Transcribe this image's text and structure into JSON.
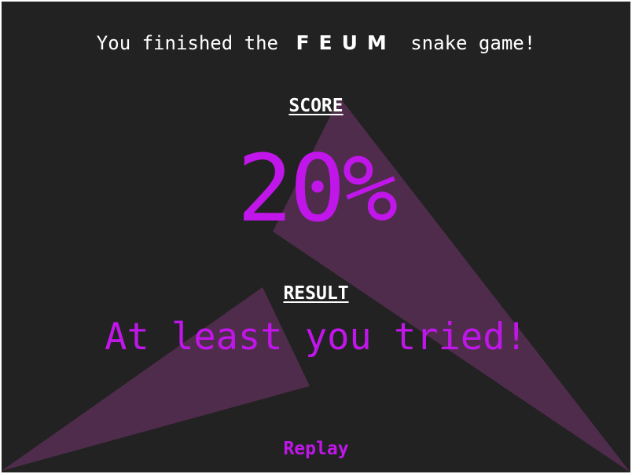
{
  "intro": {
    "prefix": "You finished the",
    "brand": "FEUM",
    "suffix": "snake game!"
  },
  "score": {
    "label": "SCORE",
    "value": "20%"
  },
  "result": {
    "label": "RESULT",
    "value": "At least you tried!"
  },
  "replay_label": "Replay",
  "colors": {
    "background": "#222222",
    "accent": "#c016ea",
    "shape_fill": "#4f2c4b",
    "text": "#ffffff"
  }
}
